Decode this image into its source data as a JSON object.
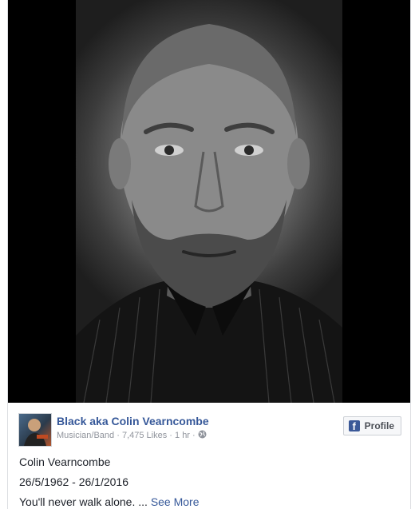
{
  "post": {
    "page_name": "Black aka Colin Vearncombe",
    "category": "Musician/Band",
    "likes": "7,475 Likes",
    "time": "1 hr",
    "separator": "·",
    "profile_button_label": "Profile",
    "fb_icon_glyph": "f",
    "lines": [
      "Colin Vearncombe",
      "26/5/1962 - 26/1/2016",
      "You'll never walk alone. ..."
    ],
    "see_more_label": "See More"
  },
  "icons": {
    "privacy": "globe-icon",
    "brand": "facebook-icon"
  },
  "colors": {
    "link": "#365899",
    "meta": "#90949c",
    "text": "#1d2129",
    "facebook_blue": "#3b5998"
  }
}
